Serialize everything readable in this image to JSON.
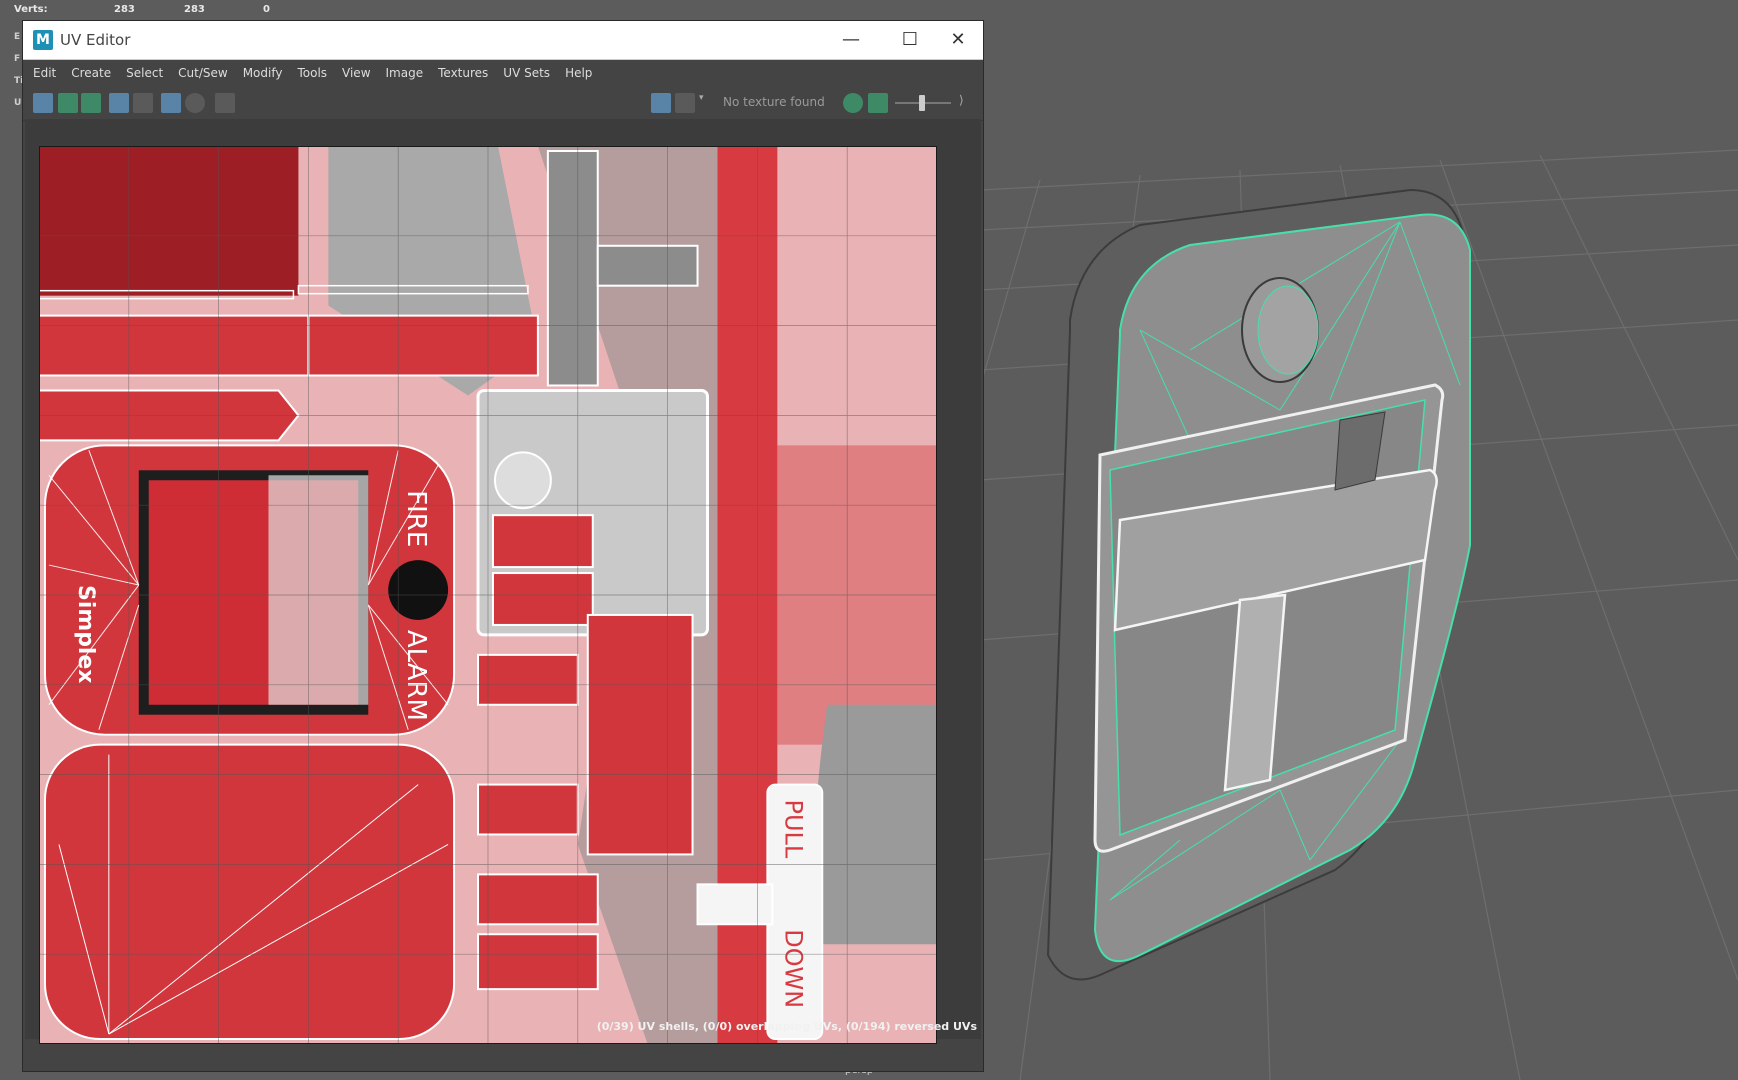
{
  "hud": {
    "verts_label": "Verts:",
    "values": [
      "283",
      "283",
      "0"
    ],
    "side_letters": [
      "E",
      "F",
      "Ti",
      "U"
    ]
  },
  "window": {
    "title": "UV Editor",
    "logo_letter": "M",
    "controls": {
      "minimize": "—",
      "maximize": "☐",
      "close": "✕"
    }
  },
  "menu": [
    "Edit",
    "Create",
    "Select",
    "Cut/Sew",
    "Modify",
    "Tools",
    "View",
    "Image",
    "Textures",
    "UV Sets",
    "Help"
  ],
  "toolbar": {
    "texture_status": "No texture found"
  },
  "uv_texture": {
    "brand": "Simplex",
    "label_fire": "FIRE",
    "label_alarm": "ALARM",
    "label_pull": "PULL",
    "label_down": "DOWN"
  },
  "status": {
    "text": "(0/39) UV shells, (0/0) overlapping UVs, (0/194) reversed UVs"
  },
  "viewport": {
    "camera": "persp"
  },
  "colors": {
    "texture_red": "#cf2d36",
    "texture_pink": "#e9b3b5",
    "wire_green": "#46e0a8",
    "viewport_bg": "#5c5c5c"
  }
}
